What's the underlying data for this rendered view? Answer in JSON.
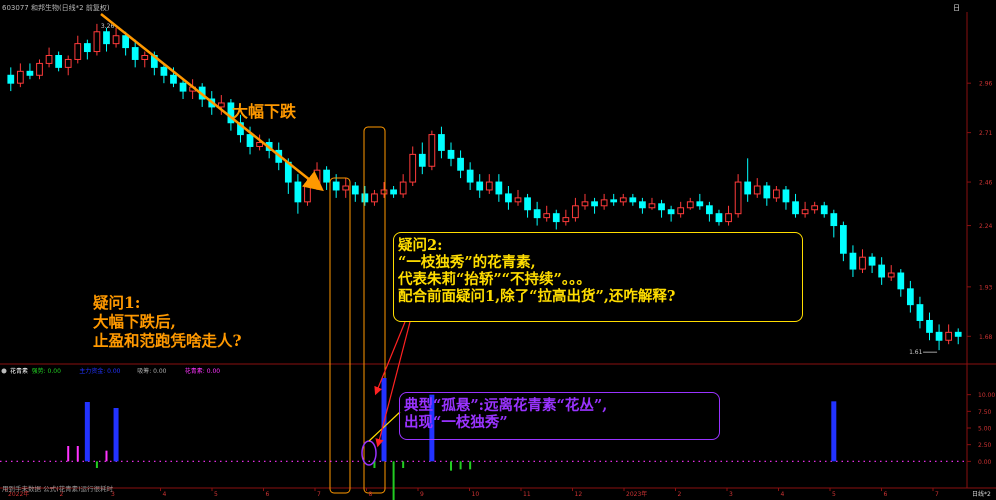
{
  "header": {
    "stock": "603077 和邦生物(日线*2 前复权)",
    "top_right": "日"
  },
  "chart_data": {
    "type": "candlestick",
    "price_axis": {
      "ticks": [
        "2.96",
        "2.71",
        "2.46",
        "2.24",
        "1.93",
        "1.68"
      ]
    },
    "price_range": [
      1.55,
      3.32
    ],
    "high_label": "3.26",
    "low_label": "1.61",
    "candles": [
      [
        3.0,
        2.96,
        3.04,
        2.92
      ],
      [
        2.96,
        3.02,
        3.06,
        2.94
      ],
      [
        3.02,
        3.0,
        3.06,
        2.98
      ],
      [
        3.0,
        3.06,
        3.08,
        2.98
      ],
      [
        3.06,
        3.1,
        3.14,
        3.04
      ],
      [
        3.1,
        3.04,
        3.12,
        3.02
      ],
      [
        3.04,
        3.08,
        3.1,
        3.0
      ],
      [
        3.08,
        3.16,
        3.2,
        3.06
      ],
      [
        3.16,
        3.12,
        3.18,
        3.08
      ],
      [
        3.12,
        3.22,
        3.26,
        3.1
      ],
      [
        3.22,
        3.16,
        3.24,
        3.12
      ],
      [
        3.16,
        3.2,
        3.24,
        3.14
      ],
      [
        3.2,
        3.14,
        3.22,
        3.1
      ],
      [
        3.14,
        3.08,
        3.18,
        3.04
      ],
      [
        3.08,
        3.1,
        3.12,
        3.04
      ],
      [
        3.1,
        3.04,
        3.12,
        3.0
      ],
      [
        3.04,
        3.0,
        3.06,
        2.96
      ],
      [
        3.0,
        2.96,
        3.04,
        2.94
      ],
      [
        2.96,
        2.92,
        2.98,
        2.88
      ],
      [
        2.92,
        2.94,
        2.98,
        2.88
      ],
      [
        2.94,
        2.88,
        2.96,
        2.84
      ],
      [
        2.88,
        2.84,
        2.92,
        2.8
      ],
      [
        2.84,
        2.86,
        2.9,
        2.8
      ],
      [
        2.86,
        2.76,
        2.88,
        2.72
      ],
      [
        2.76,
        2.7,
        2.8,
        2.66
      ],
      [
        2.7,
        2.64,
        2.74,
        2.6
      ],
      [
        2.64,
        2.66,
        2.7,
        2.62
      ],
      [
        2.66,
        2.62,
        2.68,
        2.58
      ],
      [
        2.62,
        2.56,
        2.66,
        2.52
      ],
      [
        2.56,
        2.46,
        2.58,
        2.4
      ],
      [
        2.46,
        2.36,
        2.5,
        2.3
      ],
      [
        2.36,
        2.44,
        2.48,
        2.34
      ],
      [
        2.44,
        2.52,
        2.56,
        2.42
      ],
      [
        2.52,
        2.46,
        2.54,
        2.42
      ],
      [
        2.46,
        2.42,
        2.5,
        2.38
      ],
      [
        2.42,
        2.44,
        2.48,
        2.38
      ],
      [
        2.44,
        2.4,
        2.46,
        2.36
      ],
      [
        2.4,
        2.36,
        2.44,
        2.34
      ],
      [
        2.36,
        2.4,
        2.42,
        2.34
      ],
      [
        2.4,
        2.42,
        2.46,
        2.38
      ],
      [
        2.42,
        2.4,
        2.44,
        2.38
      ],
      [
        2.4,
        2.46,
        2.5,
        2.38
      ],
      [
        2.46,
        2.6,
        2.64,
        2.44
      ],
      [
        2.6,
        2.54,
        2.66,
        2.5
      ],
      [
        2.54,
        2.7,
        2.72,
        2.52
      ],
      [
        2.7,
        2.62,
        2.74,
        2.58
      ],
      [
        2.62,
        2.58,
        2.66,
        2.54
      ],
      [
        2.58,
        2.52,
        2.62,
        2.48
      ],
      [
        2.52,
        2.46,
        2.56,
        2.42
      ],
      [
        2.46,
        2.42,
        2.5,
        2.38
      ],
      [
        2.42,
        2.46,
        2.5,
        2.4
      ],
      [
        2.46,
        2.4,
        2.5,
        2.36
      ],
      [
        2.4,
        2.36,
        2.44,
        2.32
      ],
      [
        2.36,
        2.38,
        2.42,
        2.34
      ],
      [
        2.38,
        2.32,
        2.4,
        2.28
      ],
      [
        2.32,
        2.28,
        2.36,
        2.24
      ],
      [
        2.28,
        2.3,
        2.34,
        2.26
      ],
      [
        2.3,
        2.26,
        2.32,
        2.22
      ],
      [
        2.26,
        2.28,
        2.32,
        2.24
      ],
      [
        2.28,
        2.34,
        2.38,
        2.26
      ],
      [
        2.34,
        2.36,
        2.4,
        2.32
      ],
      [
        2.36,
        2.34,
        2.38,
        2.3
      ],
      [
        2.34,
        2.37,
        2.4,
        2.32
      ],
      [
        2.37,
        2.36,
        2.4,
        2.34
      ],
      [
        2.36,
        2.38,
        2.4,
        2.34
      ],
      [
        2.38,
        2.36,
        2.4,
        2.34
      ],
      [
        2.36,
        2.33,
        2.38,
        2.3
      ],
      [
        2.33,
        2.35,
        2.38,
        2.32
      ],
      [
        2.35,
        2.32,
        2.37,
        2.28
      ],
      [
        2.32,
        2.3,
        2.34,
        2.26
      ],
      [
        2.3,
        2.33,
        2.36,
        2.28
      ],
      [
        2.33,
        2.36,
        2.38,
        2.32
      ],
      [
        2.36,
        2.34,
        2.4,
        2.32
      ],
      [
        2.34,
        2.3,
        2.36,
        2.26
      ],
      [
        2.3,
        2.26,
        2.32,
        2.24
      ],
      [
        2.26,
        2.3,
        2.34,
        2.24
      ],
      [
        2.3,
        2.46,
        2.5,
        2.28
      ],
      [
        2.46,
        2.4,
        2.58,
        2.36
      ],
      [
        2.4,
        2.44,
        2.48,
        2.38
      ],
      [
        2.44,
        2.38,
        2.46,
        2.34
      ],
      [
        2.38,
        2.42,
        2.44,
        2.36
      ],
      [
        2.42,
        2.36,
        2.44,
        2.32
      ],
      [
        2.36,
        2.3,
        2.4,
        2.28
      ],
      [
        2.3,
        2.32,
        2.36,
        2.28
      ],
      [
        2.32,
        2.34,
        2.36,
        2.3
      ],
      [
        2.34,
        2.3,
        2.36,
        2.28
      ],
      [
        2.3,
        2.24,
        2.32,
        2.18
      ],
      [
        2.24,
        2.1,
        2.26,
        2.06
      ],
      [
        2.1,
        2.02,
        2.14,
        1.98
      ],
      [
        2.02,
        2.08,
        2.12,
        2.0
      ],
      [
        2.08,
        2.04,
        2.1,
        2.0
      ],
      [
        2.04,
        1.98,
        2.08,
        1.94
      ],
      [
        1.98,
        2.0,
        2.04,
        1.96
      ],
      [
        2.0,
        1.92,
        2.02,
        1.88
      ],
      [
        1.92,
        1.84,
        1.96,
        1.8
      ],
      [
        1.84,
        1.76,
        1.88,
        1.72
      ],
      [
        1.76,
        1.7,
        1.8,
        1.66
      ],
      [
        1.7,
        1.66,
        1.74,
        1.61
      ],
      [
        1.66,
        1.7,
        1.74,
        1.64
      ],
      [
        1.7,
        1.68,
        1.72,
        1.64
      ]
    ],
    "indicator": {
      "name": "花青素",
      "legend": [
        "花青素",
        "强势: 0.00",
        "主力资金: 0.00",
        "吸筹: 0.00",
        "花青素: 0.00"
      ],
      "range": [
        -2.5,
        12.5
      ],
      "ticks": [
        "10.00",
        "7.50",
        "5.00",
        "2.50",
        "0.00"
      ],
      "bars": [
        {
          "index": 6,
          "value": 2.3,
          "color": "#ff33ff"
        },
        {
          "index": 7,
          "value": 2.3,
          "color": "#ff33ff"
        },
        {
          "index": 8,
          "value": 8.9,
          "color": "#2233ff"
        },
        {
          "index": 9,
          "value": -1.0,
          "color": "#22cc22"
        },
        {
          "index": 10,
          "value": 1.6,
          "color": "#ff33ff"
        },
        {
          "index": 11,
          "value": 8.0,
          "color": "#2233ff"
        },
        {
          "index": 38,
          "value": -1.0,
          "color": "#22cc22"
        },
        {
          "index": 39,
          "value": 12.5,
          "color": "#2233ff"
        },
        {
          "index": 40,
          "value": -6.2,
          "color": "#22cc22"
        },
        {
          "index": 41,
          "value": -1.0,
          "color": "#22cc22"
        },
        {
          "index": 44,
          "value": 10.0,
          "color": "#2233ff"
        },
        {
          "index": 46,
          "value": -1.4,
          "color": "#22cc22"
        },
        {
          "index": 47,
          "value": -1.2,
          "color": "#22cc22"
        },
        {
          "index": 48,
          "value": -1.2,
          "color": "#22cc22"
        },
        {
          "index": 86,
          "value": 9.0,
          "color": "#2233ff"
        }
      ]
    },
    "date_axis": {
      "labels": [
        "2022年",
        "2",
        "3",
        "4",
        "5",
        "6",
        "7",
        "8",
        "9",
        "10",
        "11",
        "12",
        "2023年",
        "2",
        "3",
        "4",
        "5",
        "6",
        "7"
      ],
      "right_label": "日线*2"
    }
  },
  "annotations": {
    "decline_label": "大幅下跌",
    "q1_title": "疑问1:",
    "q1_line1": "大幅下跌后,",
    "q1_line2": "止盈和范跑凭啥走人?",
    "q2_title": "疑问2:",
    "q2_line1": "“一枝独秀”的花青素,",
    "q2_line2": "代表朱莉“抬轿”“不持续”。。。",
    "q2_line3": "配合前面疑问1,除了“拉高出货”,还咋解释?",
    "typical_line1": "典型“孤悬”:远离花青素“花丛”,",
    "typical_line2": "出现“一枝独秀”"
  },
  "footer": {
    "line1": "用到手未数据  公式(花青素)运行很耗时"
  },
  "colors": {
    "up": "#ff3b3b",
    "down": "#00ffff",
    "orange": "#ff9900",
    "yellow": "#ffdd00",
    "purple": "#9933ff",
    "axis": "#8a1010"
  }
}
